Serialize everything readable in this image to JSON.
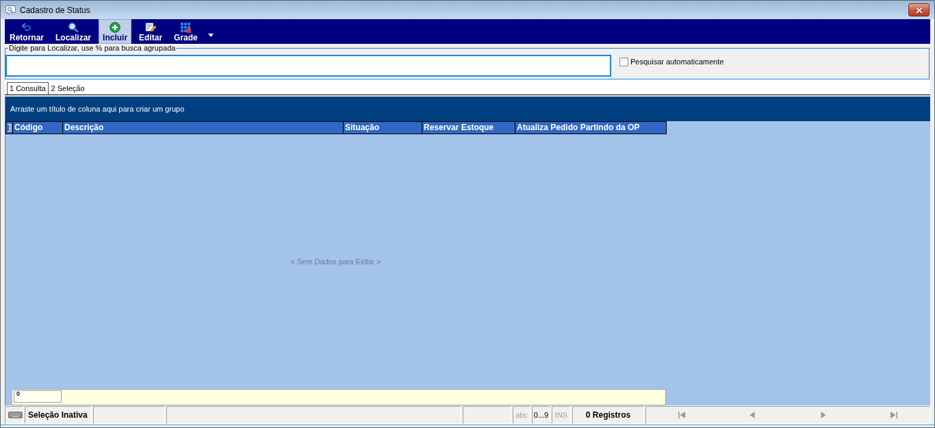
{
  "window": {
    "title": "Cadastro de Status"
  },
  "toolbar": [
    {
      "label": "Retornar",
      "hovered": false
    },
    {
      "label": "Localizar",
      "hovered": false
    },
    {
      "label": "Incluir",
      "hovered": true
    },
    {
      "label": "Editar",
      "hovered": false
    },
    {
      "label": "Grade",
      "hovered": false
    }
  ],
  "search": {
    "label": "Digite para Localizar, use % para busca agrupada",
    "focused": true
  },
  "auto_search": {
    "label": "Pesquisar automaticamente",
    "checked": false
  },
  "tabs": [
    {
      "label": "1 Consulta",
      "selected": true
    },
    {
      "label": "2 Seleção",
      "selected": false
    }
  ],
  "grid": {
    "group_hint": "Arraste um título de coluna aqui para criar um grupo",
    "columns": [
      "Código",
      "Descrição",
      "Situação",
      "Reservar Estoque",
      "Atualiza Pedido Partindo da OP"
    ],
    "empty_message": "< Sem Dados para Exibir >",
    "filter_value": "0"
  },
  "status_bar": {
    "selection": "Seleção Inativa",
    "indicators": [
      {
        "label": "abc",
        "on": false
      },
      {
        "label": "0...9",
        "on": true
      },
      {
        "label": "INS",
        "on": false
      }
    ],
    "record_count": "0 Registros",
    "nav_buttons": [
      {
        "disabled": true
      },
      {
        "disabled": true
      },
      {
        "disabled": true
      },
      {
        "disabled": true
      }
    ]
  }
}
